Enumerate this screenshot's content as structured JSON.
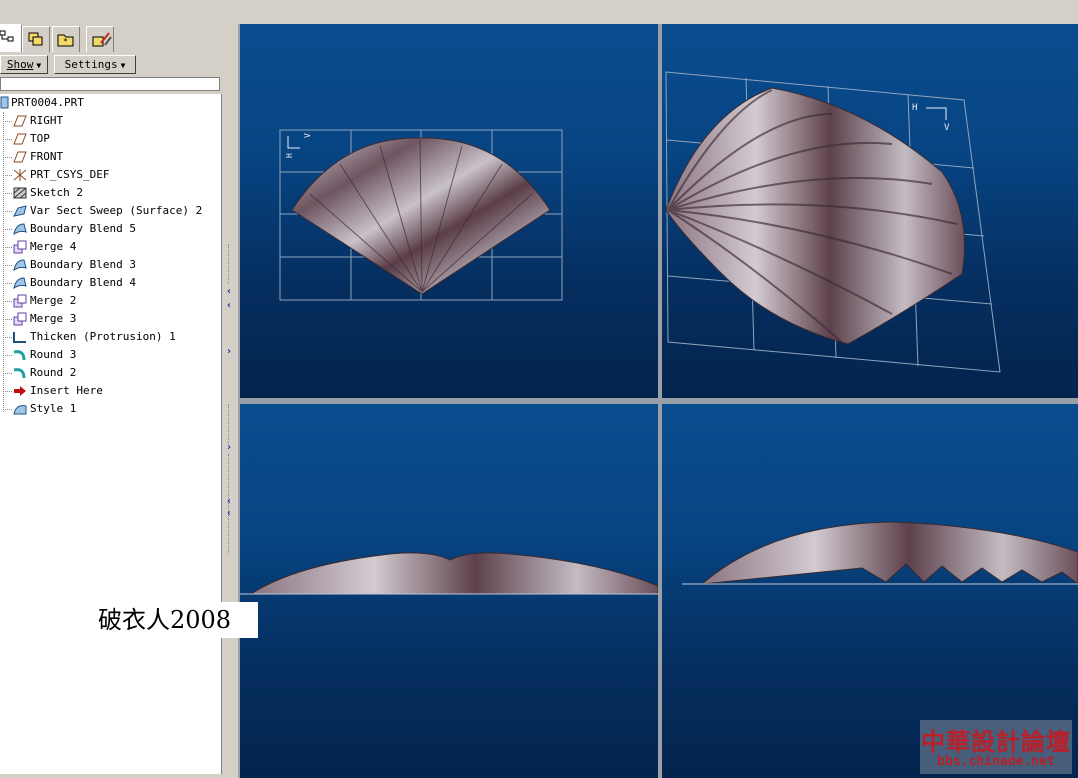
{
  "toolbar": {
    "tabs": [
      "model-tree-icon",
      "layers-icon",
      "folder-icon",
      "tools-icon"
    ],
    "show_label": "Show",
    "settings_label": "Settings"
  },
  "tree": {
    "root": "PRT0004.PRT",
    "items": [
      {
        "label": "RIGHT",
        "icon": "datum-plane-icon"
      },
      {
        "label": "TOP",
        "icon": "datum-plane-icon"
      },
      {
        "label": "FRONT",
        "icon": "datum-plane-icon"
      },
      {
        "label": "PRT_CSYS_DEF",
        "icon": "csys-icon"
      },
      {
        "label": "Sketch 2",
        "icon": "sketch-icon"
      },
      {
        "label": "Var Sect Sweep (Surface) 2",
        "icon": "sweep-icon"
      },
      {
        "label": "Boundary Blend 5",
        "icon": "blend-icon"
      },
      {
        "label": "Merge 4",
        "icon": "merge-icon"
      },
      {
        "label": "Boundary Blend 3",
        "icon": "blend-icon"
      },
      {
        "label": "Boundary Blend 4",
        "icon": "blend-icon"
      },
      {
        "label": "Merge 2",
        "icon": "merge-icon"
      },
      {
        "label": "Merge 3",
        "icon": "merge-icon"
      },
      {
        "label": "Thicken (Protrusion) 1",
        "icon": "thicken-icon"
      },
      {
        "label": "Round 3",
        "icon": "round-icon"
      },
      {
        "label": "Round 2",
        "icon": "round-icon"
      },
      {
        "label": "Insert Here",
        "icon": "insert-arrow-icon"
      },
      {
        "label": "Style 1",
        "icon": "style-icon"
      }
    ]
  },
  "viewports": {
    "top_view_axes": [
      "H",
      "V"
    ],
    "iso_view_axes": [
      "H",
      "V"
    ]
  },
  "overlay": {
    "signature": "破衣人2008",
    "watermark_title": "中華設計論壇",
    "watermark_url": "bbs.chinade.net"
  },
  "colors": {
    "viewport_top": "#0a4d8f",
    "viewport_bottom": "#03244d",
    "watermark": "#b8202a"
  }
}
